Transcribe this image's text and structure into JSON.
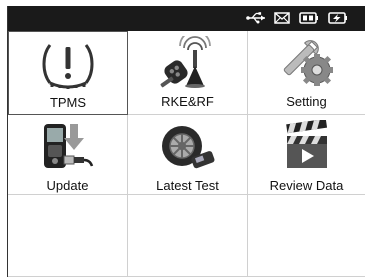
{
  "status_bar": {
    "icons": [
      "usb-icon",
      "mail-icon",
      "battery-icon",
      "charging-battery-icon"
    ]
  },
  "menu": {
    "items": [
      {
        "label": "TPMS",
        "icon": "tpms-warning-icon",
        "selected": true
      },
      {
        "label": "RKE&RF",
        "icon": "key-fob-icon",
        "selected": false
      },
      {
        "label": "Setting",
        "icon": "wrench-gear-icon",
        "selected": false
      },
      {
        "label": "Update",
        "icon": "device-usb-update-icon",
        "selected": false
      },
      {
        "label": "Latest Test",
        "icon": "tire-sensor-icon",
        "selected": false
      },
      {
        "label": "Review  Data",
        "icon": "clapperboard-icon",
        "selected": false
      }
    ]
  }
}
